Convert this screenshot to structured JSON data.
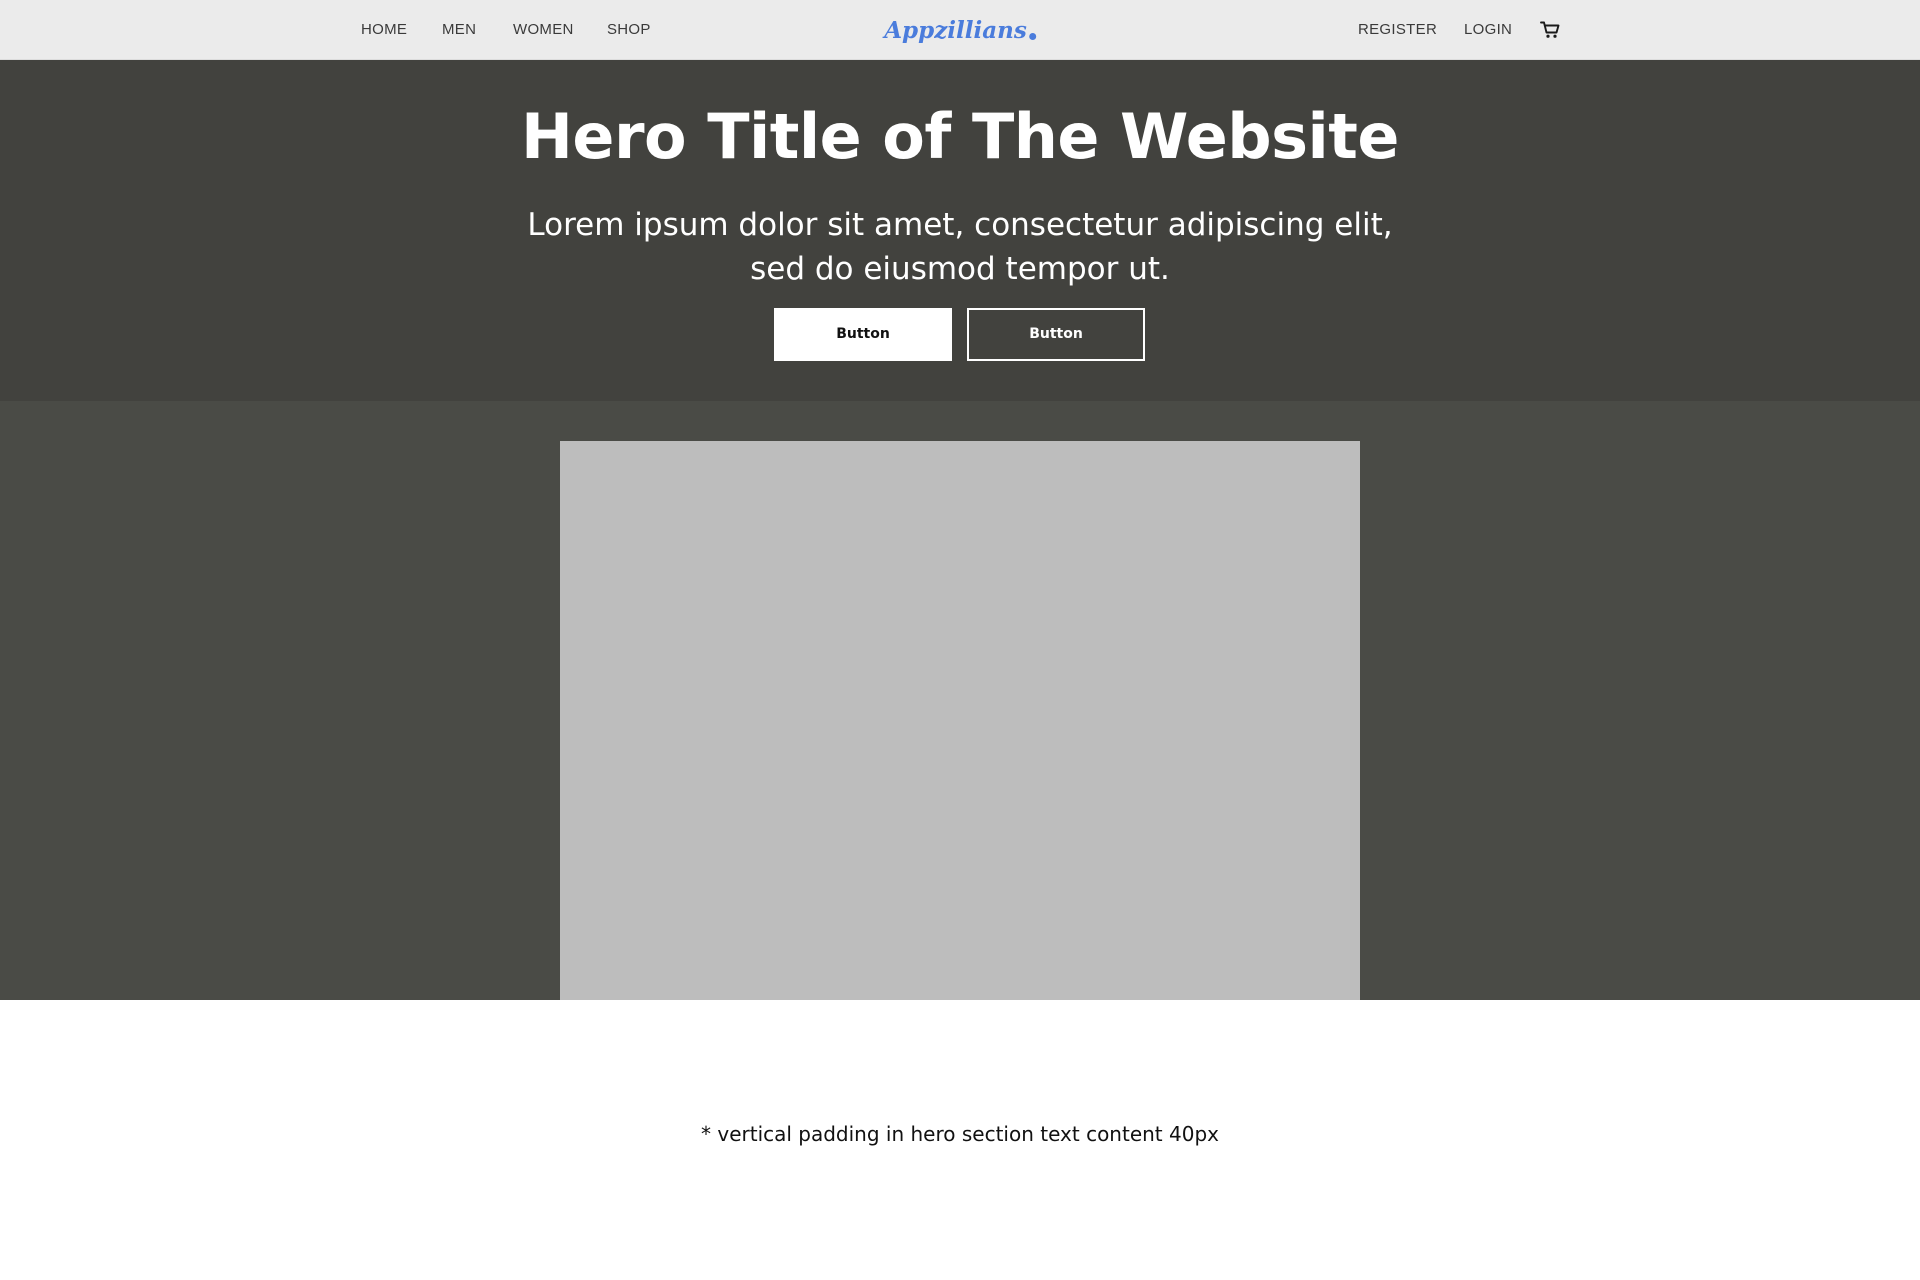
{
  "nav": {
    "left_links": [
      "HOME",
      "MEN",
      "WOMEN",
      "SHOP"
    ],
    "logo_text": "Appzillians",
    "right_links": [
      "REGISTER",
      "LOGIN"
    ],
    "cart_icon": "cart-icon"
  },
  "hero": {
    "title": "Hero Title of The Website",
    "subtitle_line1": "Lorem ipsum dolor sit amet, consectetur adipiscing elit,",
    "subtitle_line2": "sed do eiusmod tempor ut.",
    "primary_button": "Button",
    "secondary_button": "Button"
  },
  "note": "* vertical padding in hero section text content 40px",
  "colors": {
    "nav_bg": "#ebebeb",
    "logo": "#4a7cdc",
    "hero_text_bg": "#42423e",
    "hero_media_bg": "#4a4b46",
    "image_placeholder": "#bdbdbd"
  }
}
